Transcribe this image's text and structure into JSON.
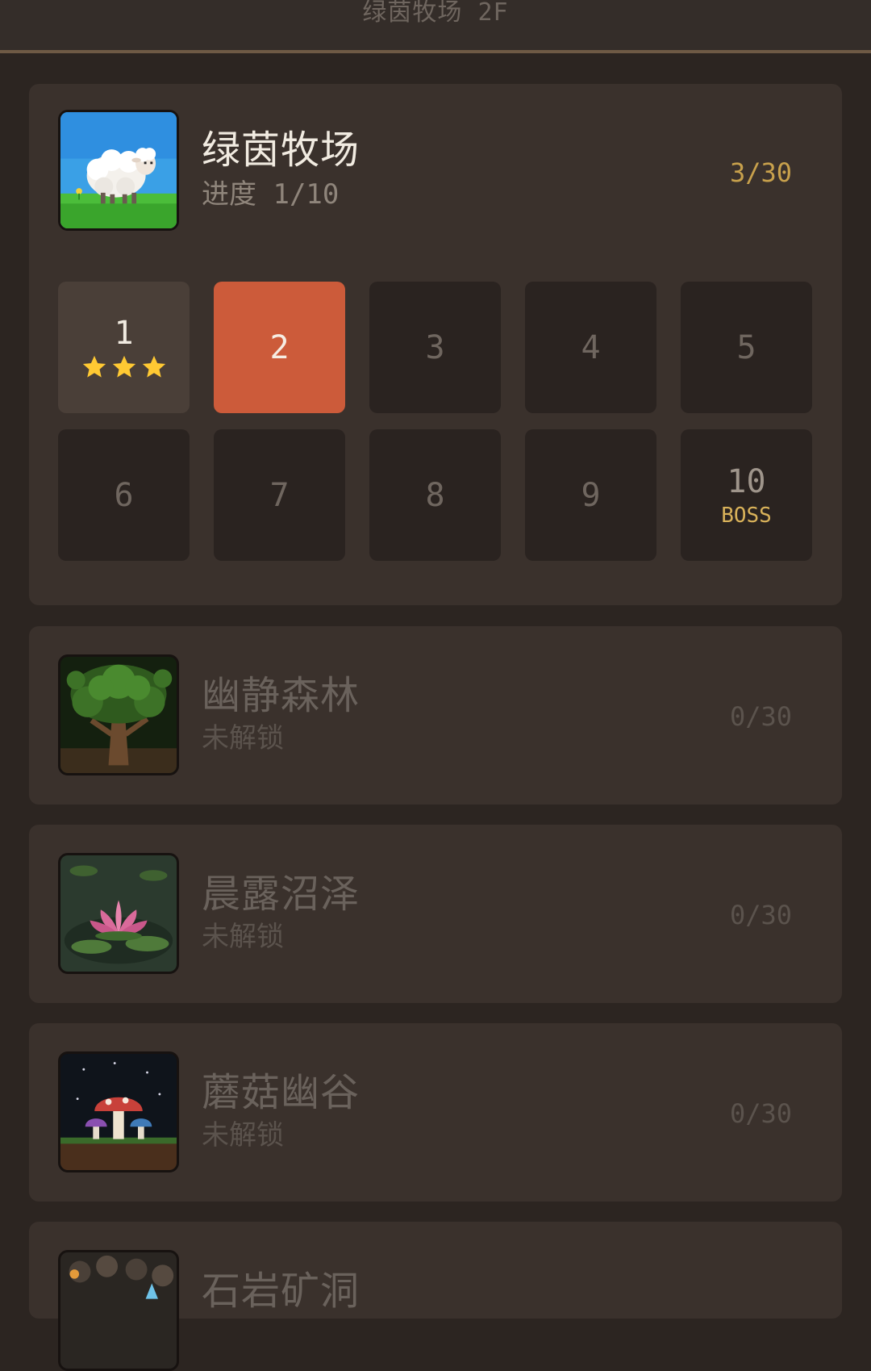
{
  "header": {
    "title": "绿茵牧场 2F"
  },
  "active_zone": {
    "name": "绿茵牧场",
    "progress_text": "进度 1/10",
    "star_count": "3/30",
    "thumbnail": "sheep-icon",
    "levels": [
      {
        "label": "1",
        "state": "cleared",
        "stars": 3
      },
      {
        "label": "2",
        "state": "current"
      },
      {
        "label": "3",
        "state": "locked"
      },
      {
        "label": "4",
        "state": "locked"
      },
      {
        "label": "5",
        "state": "locked"
      },
      {
        "label": "6",
        "state": "locked"
      },
      {
        "label": "7",
        "state": "locked"
      },
      {
        "label": "8",
        "state": "locked"
      },
      {
        "label": "9",
        "state": "locked"
      },
      {
        "label": "10",
        "state": "boss",
        "tag": "BOSS"
      }
    ]
  },
  "locked_zones": [
    {
      "name": "幽静森林",
      "status": "未解锁",
      "star_count": "0/30",
      "thumbnail": "tree-icon"
    },
    {
      "name": "晨露沼泽",
      "status": "未解锁",
      "star_count": "0/30",
      "thumbnail": "lotus-icon"
    },
    {
      "name": "蘑菇幽谷",
      "status": "未解锁",
      "star_count": "0/30",
      "thumbnail": "mushroom-icon"
    },
    {
      "name": "石岩矿洞",
      "status": "",
      "star_count": "",
      "thumbnail": "cave-icon"
    }
  ],
  "colors": {
    "background": "#2c2521",
    "card": "#3a312c",
    "accent_current": "#cc5b3a",
    "star": "#ffc933",
    "boss_tag": "#d9b25a",
    "count_active": "#c8a14c"
  }
}
